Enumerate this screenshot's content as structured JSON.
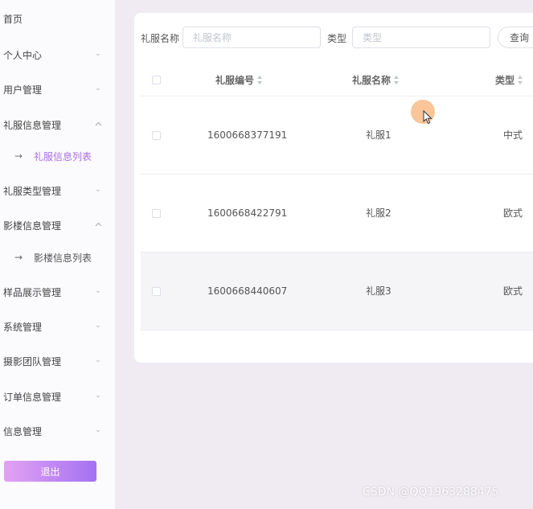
{
  "sidebar": {
    "home": "首页",
    "items": [
      {
        "label": "个人中心",
        "expanded": false
      },
      {
        "label": "用户管理",
        "expanded": false
      },
      {
        "label": "礼服信息管理",
        "expanded": true,
        "sub": "礼服信息列表"
      },
      {
        "label": "礼服类型管理",
        "expanded": false
      },
      {
        "label": "影楼信息管理",
        "expanded": true,
        "sub": "影楼信息列表"
      },
      {
        "label": "样品展示管理",
        "expanded": false
      },
      {
        "label": "系统管理",
        "expanded": false
      },
      {
        "label": "摄影团队管理",
        "expanded": false
      },
      {
        "label": "订单信息管理",
        "expanded": false
      },
      {
        "label": "信息管理",
        "expanded": false
      }
    ],
    "logout": "退出",
    "accent_color": "#a86ee8"
  },
  "search": {
    "name_label": "礼服名称",
    "name_placeholder": "礼服名称",
    "type_label": "类型",
    "type_placeholder": "类型",
    "query_button": "查询"
  },
  "table": {
    "columns": [
      "礼服编号",
      "礼服名称",
      "类型"
    ],
    "rows": [
      {
        "id": "1600668377191",
        "name": "礼服1",
        "type": "中式"
      },
      {
        "id": "1600668422791",
        "name": "礼服2",
        "type": "欧式"
      },
      {
        "id": "1600668440607",
        "name": "礼服3",
        "type": "欧式"
      }
    ]
  },
  "watermark": "CSDN @QQ1963288475"
}
